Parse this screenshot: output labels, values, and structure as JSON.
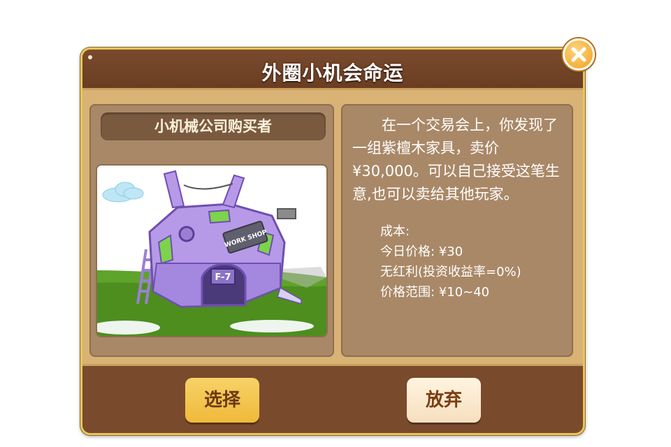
{
  "dialog": {
    "title": "外圈小机会命运",
    "card": {
      "name": "小机械公司购买者",
      "image_label": "WORK SHOP",
      "image_sign": "F-7"
    },
    "story": "在一个交易会上，你发现了一组紫檀木家具，卖价¥30,000。可以自己接受这笔生意,也可以卖给其他玩家。",
    "stats": [
      "成本:",
      "今日价格: ¥30",
      "无红利(投资收益率=0%)",
      "价格范围: ¥10~40"
    ],
    "buttons": {
      "select_label": "选择",
      "giveup_label": "放弃"
    }
  },
  "colors": {
    "header": "#7a4a2d",
    "panel": "#a98867",
    "frame": "#d9b275",
    "select_button": "#f0b93a",
    "giveup_button": "#f6dfbf",
    "close_button": "#f0a122"
  },
  "icons": {
    "close": "close-x-icon"
  }
}
